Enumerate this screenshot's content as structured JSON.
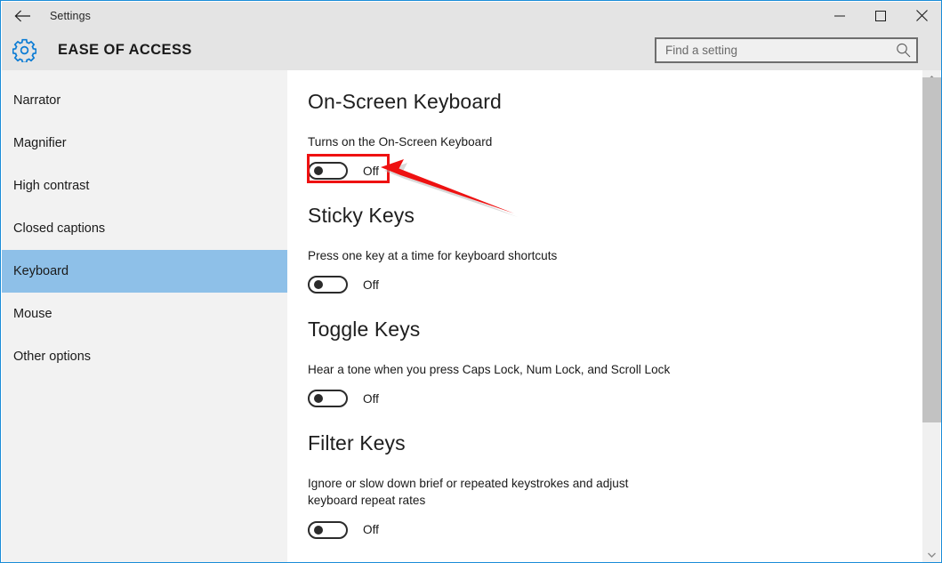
{
  "window": {
    "title": "Settings",
    "back_icon": "back-arrow-icon",
    "minimize_label": "─",
    "maximize_label": "□",
    "close_label": "×",
    "border_color": "#1a8cd8",
    "titlebar_color": "#e4e4e4"
  },
  "header": {
    "icon": "gear-icon",
    "title": "EASE OF ACCESS",
    "accent_color": "#0a7bd4"
  },
  "search": {
    "placeholder": "Find a setting",
    "value": "",
    "icon": "search-icon"
  },
  "sidebar": {
    "selected_index": 4,
    "selected_color": "#8ec0e8",
    "items": [
      {
        "label": "Narrator"
      },
      {
        "label": "Magnifier"
      },
      {
        "label": "High contrast"
      },
      {
        "label": "Closed captions"
      },
      {
        "label": "Keyboard"
      },
      {
        "label": "Mouse"
      },
      {
        "label": "Other options"
      }
    ]
  },
  "main": {
    "sections": [
      {
        "title": "On-Screen Keyboard",
        "description": "Turns on the On-Screen Keyboard",
        "toggle_state": "Off",
        "highlighted": true
      },
      {
        "title": "Sticky Keys",
        "description": "Press one key at a time for keyboard shortcuts",
        "toggle_state": "Off",
        "highlighted": false
      },
      {
        "title": "Toggle Keys",
        "description": "Hear a tone when you press Caps Lock, Num Lock, and Scroll Lock",
        "toggle_state": "Off",
        "highlighted": false
      },
      {
        "title": "Filter Keys",
        "description": "Ignore or slow down brief or repeated keystrokes and adjust keyboard repeat rates",
        "toggle_state": "Off",
        "highlighted": false
      }
    ]
  },
  "annotation": {
    "highlight_color": "#ee1111",
    "arrow_color": "#ee1111",
    "arrow_name": "red-pointer-arrow"
  },
  "scrollbar": {
    "up_icon": "scroll-up-arrow-icon",
    "down_icon": "scroll-down-arrow-icon",
    "thumb_color": "#c2c2c2"
  }
}
